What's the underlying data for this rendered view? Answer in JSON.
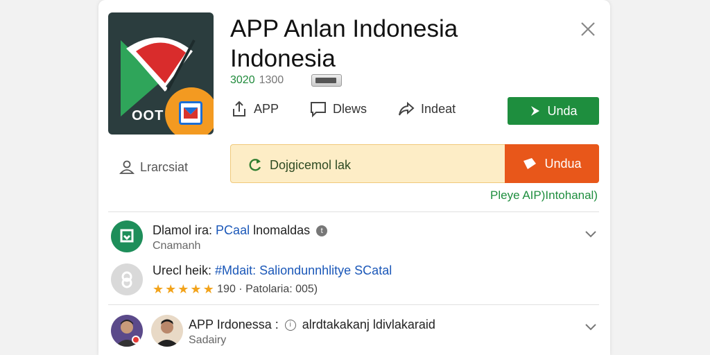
{
  "app": {
    "title_line1": "APP Anlan Indonesia",
    "title_line2": "Indonesia",
    "meta_green": "3020",
    "meta_gray": "1300",
    "icon_text": "OOT"
  },
  "actions": [
    {
      "label": "APP",
      "icon": "share-icon"
    },
    {
      "label": "Dlews",
      "icon": "comment-icon"
    },
    {
      "label": "Indeat",
      "icon": "forward-icon"
    }
  ],
  "primary_button": {
    "label": "Unda"
  },
  "user_link": {
    "label": "Lrarcsiat"
  },
  "banner": {
    "text": "Dojgicemol lak",
    "button_label": "Undua"
  },
  "play_note": "Pleye AIP)Intohanal)",
  "rows": [
    {
      "line1_prefix": "Dlamol ira:",
      "line1_blue": "PCaal",
      "line1_rest": "lnomaldas",
      "line2": "Cnamanh"
    },
    {
      "line1_prefix": "Urecl heik:",
      "line1_blue": "#Mdait: Saliondunnhlitye SCatal",
      "rating": "190 · Patolaria: 005)",
      "stars": 5
    },
    {
      "line1_prefix": "APP Irdonessa :",
      "line1_rest": "alrdtakakanj ldivlakaraid",
      "line2": "Sadairy"
    }
  ],
  "colors": {
    "green": "#1e8e3e",
    "orange": "#e8571a",
    "banner_bg": "#fdedc6",
    "star": "#f2a31b",
    "link_blue": "#1a57b8"
  }
}
